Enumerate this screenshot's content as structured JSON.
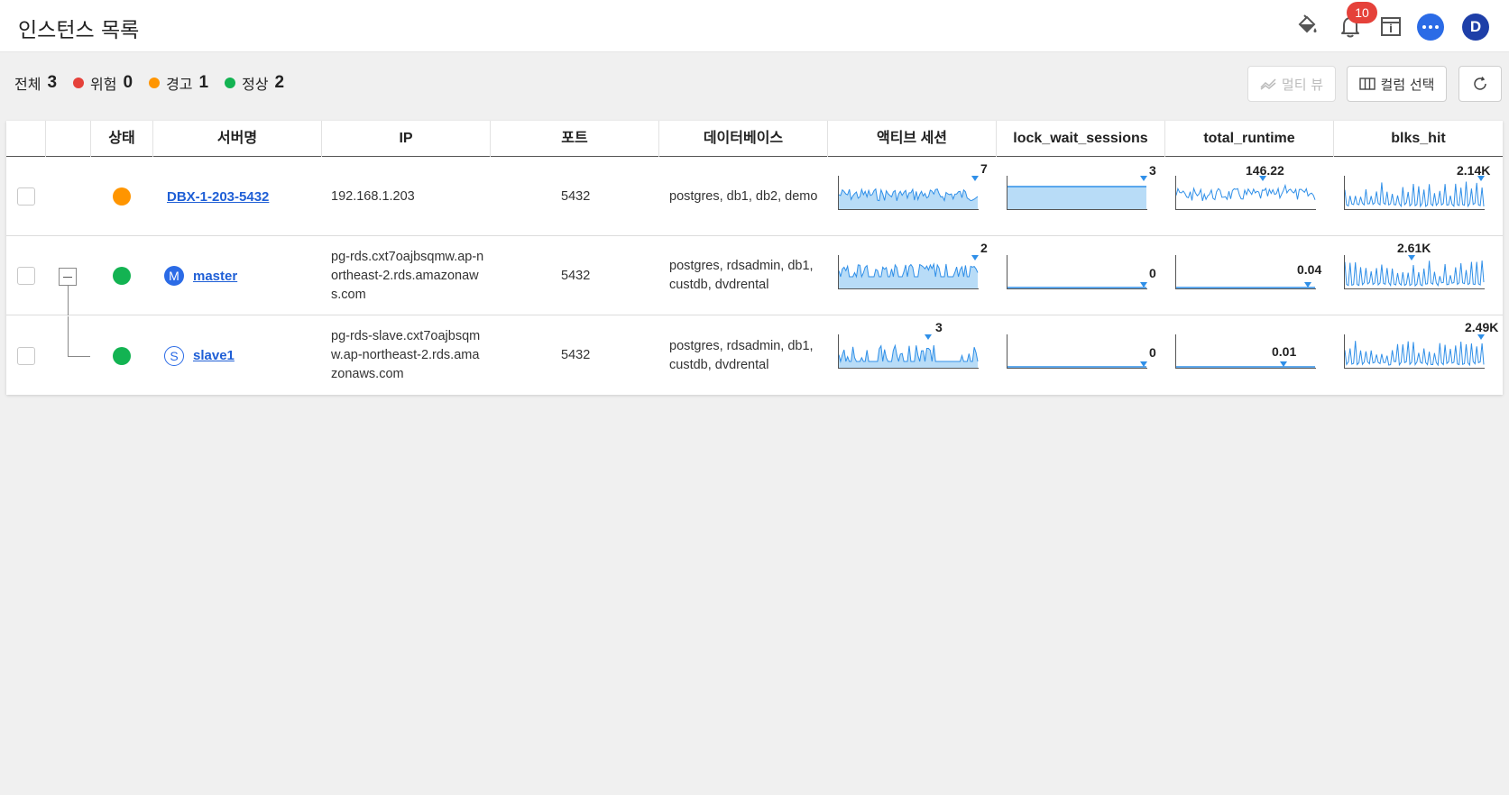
{
  "header": {
    "title": "인스턴스 목록",
    "notification_count": "10",
    "avatar_letter": "D"
  },
  "summary": {
    "total": {
      "label": "전체",
      "count": "3"
    },
    "danger": {
      "label": "위험",
      "count": "0",
      "color": "#e5413a"
    },
    "warning": {
      "label": "경고",
      "count": "1",
      "color": "#ff9500"
    },
    "normal": {
      "label": "정상",
      "count": "2",
      "color": "#13b352"
    }
  },
  "toolbar": {
    "multi_view_label": "멀티 뷰",
    "column_select_label": "컬럼 선택"
  },
  "table": {
    "columns": [
      "상태",
      "서버명",
      "IP",
      "포트",
      "데이터베이스",
      "액티브 세션",
      "lock_wait_sessions",
      "total_runtime",
      "blks_hit"
    ],
    "rows": [
      {
        "status_color": "#ff9500",
        "role": "",
        "server": "DBX-1-203-5432",
        "ip": "192.168.1.203",
        "port": "5432",
        "databases": "postgres, db1, db2, demo",
        "active_sessions": "7",
        "lock_wait_sessions": "3",
        "total_runtime": "146.22",
        "blks_hit": "2.14K"
      },
      {
        "status_color": "#13b352",
        "role": "M",
        "server": "master",
        "ip": "pg-rds.cxt7oajbsqmw.ap-northeast-2.rds.amazonaws.com",
        "port": "5432",
        "databases": "postgres, rdsadmin, db1, custdb, dvdrental",
        "active_sessions": "2",
        "lock_wait_sessions": "0",
        "total_runtime": "0.04",
        "blks_hit": "2.61K"
      },
      {
        "status_color": "#13b352",
        "role": "S",
        "server": "slave1",
        "ip": "pg-rds-slave.cxt7oajbsqmw.ap-northeast-2.rds.amazonaws.com",
        "port": "5432",
        "databases": "postgres, rdsadmin, db1, custdb, dvdrental",
        "active_sessions": "3",
        "lock_wait_sessions": "0",
        "total_runtime": "0.01",
        "blks_hit": "2.49K"
      }
    ]
  },
  "colors": {
    "spark_line": "#2f8fe8",
    "spark_fill": "#b8dcf7",
    "link": "#1f5fd6"
  }
}
